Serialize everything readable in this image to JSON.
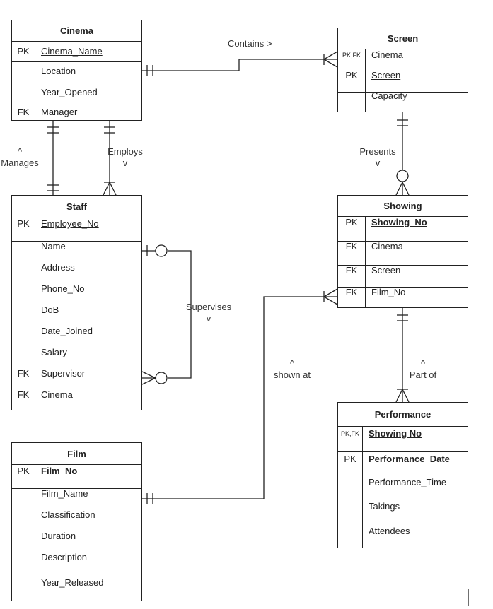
{
  "entities": {
    "cinema": {
      "title": "Cinema",
      "rows": [
        {
          "key": "PK",
          "name": "Cinema_Name",
          "underline": true
        },
        {
          "key": "",
          "name": "Location"
        },
        {
          "key": "",
          "name": "Year_Opened"
        },
        {
          "key": "FK",
          "name": "Manager"
        }
      ]
    },
    "screen": {
      "title": "Screen",
      "rows": [
        {
          "key": "PK,FK",
          "name": "Cinema",
          "underline": true
        },
        {
          "key": "PK",
          "name": "Screen",
          "underline": true
        },
        {
          "key": "",
          "name": "Capacity"
        }
      ]
    },
    "staff": {
      "title": "Staff",
      "rows": [
        {
          "key": "PK",
          "name": "Employee_No",
          "underline": true
        },
        {
          "key": "",
          "name": "Name"
        },
        {
          "key": "",
          "name": "Address"
        },
        {
          "key": "",
          "name": "Phone_No"
        },
        {
          "key": "",
          "name": "DoB"
        },
        {
          "key": "",
          "name": "Date_Joined"
        },
        {
          "key": "",
          "name": "Salary"
        },
        {
          "key": "FK",
          "name": "Supervisor"
        },
        {
          "key": "FK",
          "name": "Cinema"
        }
      ]
    },
    "showing": {
      "title": "Showing",
      "rows": [
        {
          "key": "PK",
          "name": "Showing_No",
          "underline": true,
          "bold": true
        },
        {
          "key": "FK",
          "name": "Cinema"
        },
        {
          "key": "FK",
          "name": "Screen"
        },
        {
          "key": "FK",
          "name": "Film_No"
        }
      ]
    },
    "performance": {
      "title": "Performance",
      "rows": [
        {
          "key": "PK,FK",
          "name": "Showing No",
          "underline": true,
          "bold": true
        },
        {
          "key": "PK",
          "name": "Performance_Date",
          "underline": true,
          "bold": true
        },
        {
          "key": "",
          "name": "Performance_Time"
        },
        {
          "key": "",
          "name": "Takings"
        },
        {
          "key": "",
          "name": "Attendees"
        }
      ]
    },
    "film": {
      "title": "Film",
      "rows": [
        {
          "key": "PK",
          "name": "Film_No",
          "underline": true,
          "bold": true
        },
        {
          "key": "",
          "name": "Film_Name"
        },
        {
          "key": "",
          "name": "Classification"
        },
        {
          "key": "",
          "name": "Duration"
        },
        {
          "key": "",
          "name": "Description"
        },
        {
          "key": "",
          "name": "Year_Released"
        }
      ]
    }
  },
  "relationships": {
    "contains": {
      "line1": "Contains >",
      "line2": ""
    },
    "manages": {
      "line1": "^",
      "line2": "Manages"
    },
    "employs": {
      "line1": "Employs",
      "line2": "v"
    },
    "presents": {
      "line1": "Presents",
      "line2": "v"
    },
    "supervises": {
      "line1": "Supervises",
      "line2": "v"
    },
    "shown_at": {
      "line1": "^",
      "line2": "shown at"
    },
    "part_of": {
      "line1": "^",
      "line2": "Part of"
    }
  }
}
